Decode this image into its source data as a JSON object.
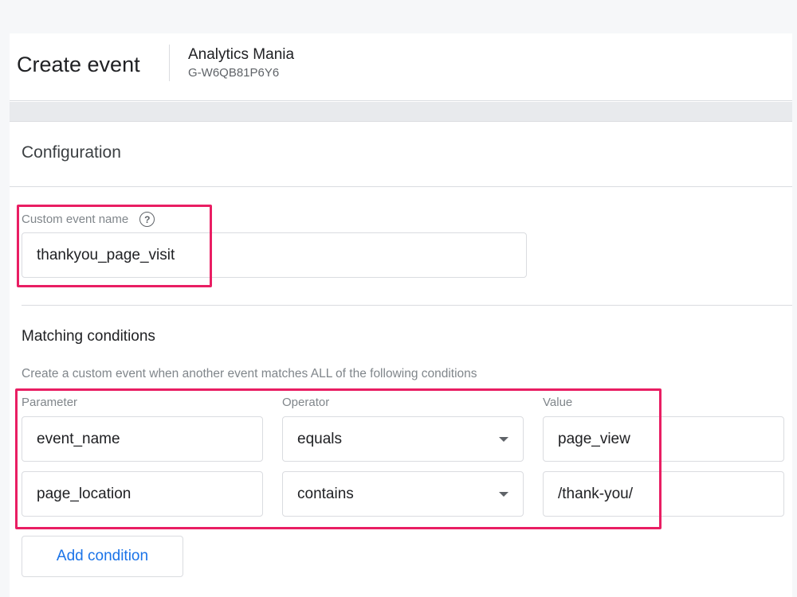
{
  "header": {
    "title": "Create event",
    "account_name": "Analytics Mania",
    "property_id": "G-W6QB81P6Y6"
  },
  "configuration": {
    "section_title": "Configuration",
    "custom_event_name_label": "Custom event name",
    "custom_event_name_value": "thankyou_page_visit",
    "help_icon": "help-circle-icon"
  },
  "matching": {
    "title": "Matching conditions",
    "description": "Create a custom event when another event matches ALL of the following conditions",
    "columns": {
      "parameter": "Parameter",
      "operator": "Operator",
      "value": "Value"
    },
    "conditions": [
      {
        "parameter": "event_name",
        "operator": "equals",
        "value": "page_view"
      },
      {
        "parameter": "page_location",
        "operator": "contains",
        "value": "/thank-you/"
      }
    ],
    "add_condition_label": "Add condition"
  },
  "colors": {
    "highlight": "#e91e63",
    "accent": "#1a73e8"
  }
}
